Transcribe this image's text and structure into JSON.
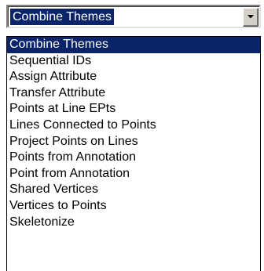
{
  "combo": {
    "value": "Combine Themes",
    "button_icon": "chevron-down-icon"
  },
  "dropdown": {
    "selected_index": 0,
    "options": [
      "Combine Themes",
      "Sequential IDs",
      "Assign Attribute",
      "Transfer Attribute",
      "Points at Line EPts",
      "Lines Connected to Points",
      "Project Points on Lines",
      "Points from Annotation",
      "Point from Annotation",
      "Shared Vertices",
      "Vertices to Points",
      "Skeletonize"
    ]
  },
  "colors": {
    "highlight": "#0a246a",
    "highlight_text": "#ffffff",
    "button_face": "#d4d0c8"
  }
}
